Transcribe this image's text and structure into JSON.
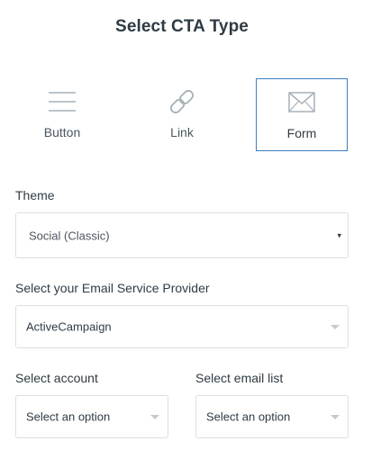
{
  "header": {
    "title": "Select CTA Type"
  },
  "cta_types": [
    {
      "label": "Button",
      "icon": "hamburger-lines-icon",
      "selected": false
    },
    {
      "label": "Link",
      "icon": "chain-link-icon",
      "selected": false
    },
    {
      "label": "Form",
      "icon": "envelope-icon",
      "selected": true
    }
  ],
  "theme": {
    "label": "Theme",
    "value": "Social (Classic)",
    "arrow": "▾"
  },
  "email_provider": {
    "label": "Select your Email Service Provider",
    "value": "ActiveCampaign"
  },
  "account": {
    "label": "Select account",
    "value": "Select an option"
  },
  "email_list": {
    "label": "Select email list",
    "value": "Select an option"
  },
  "colors": {
    "accent": "#3d7ec1",
    "icon": "#a6b0b8",
    "text": "#2f3b44",
    "border": "#dcdfe3"
  }
}
